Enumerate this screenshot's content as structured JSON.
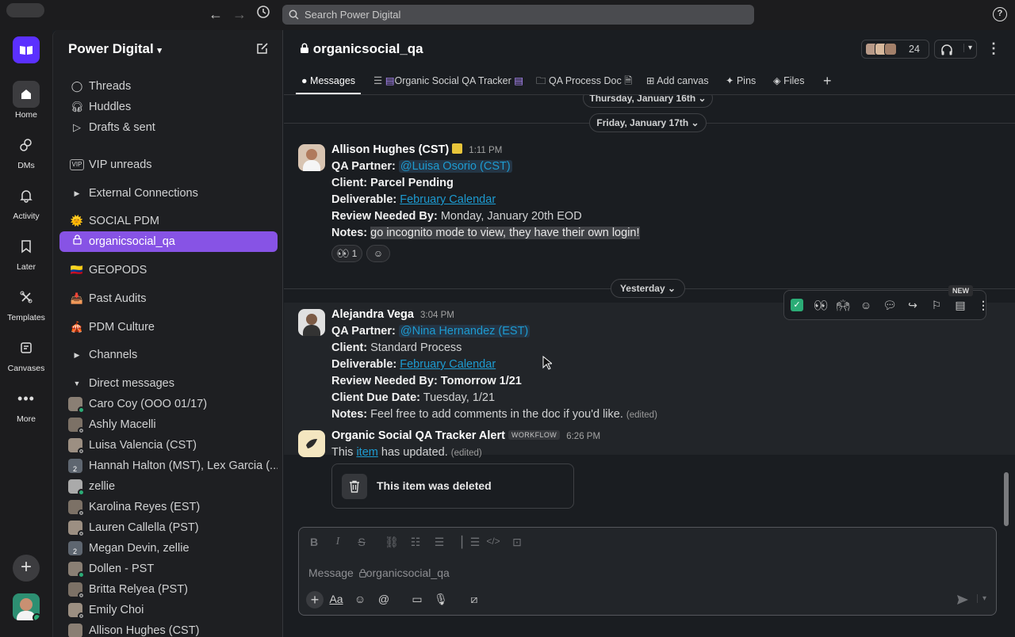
{
  "search": {
    "placeholder": "Search Power Digital"
  },
  "help_icon": "?",
  "rail": [
    {
      "label": "Home",
      "icon": "home-icon"
    },
    {
      "label": "DMs",
      "icon": "dms-icon"
    },
    {
      "label": "Activity",
      "icon": "bell-icon"
    },
    {
      "label": "Later",
      "icon": "bookmark-icon"
    },
    {
      "label": "Templates",
      "icon": "templates-icon"
    },
    {
      "label": "Canvases",
      "icon": "canvas-icon"
    },
    {
      "label": "More",
      "icon": "more-icon"
    }
  ],
  "workspace": {
    "name": "Power Digital"
  },
  "sidebar": {
    "top": [
      "Threads",
      "Huddles",
      "Drafts & sent",
      "VIP unreads",
      "External Connections"
    ],
    "channels": [
      "SOCIAL PDM",
      "organicsocial_qa",
      "GEOPODS",
      "Past Audits",
      "PDM Culture",
      "Channels",
      "Direct messages"
    ],
    "dms": [
      "Caro Coy (OOO 01/17)",
      "Ashly Macelli",
      "Luisa Valencia (CST)",
      "Hannah Halton (MST), Lex Garcia (...",
      "zellie",
      "Karolina Reyes (EST)",
      "Lauren Callella (PST)",
      "Megan Devin, zellie",
      "Dollen - PST",
      "Britta Relyea (PST)",
      "Emily Choi",
      "Allison Hughes (CST)"
    ],
    "group_count": "2"
  },
  "channel": {
    "name": "organicsocial_qa",
    "member_count": "24",
    "tabs": [
      "Messages",
      "Organic Social QA Tracker",
      "QA Process Doc",
      "Add canvas",
      "Pins",
      "Files"
    ]
  },
  "dates": {
    "d1": "Thursday, January 16th",
    "d2": "Friday, January 17th",
    "d3": "Yesterday"
  },
  "messages": {
    "m1": {
      "author": "Allison Hughes (CST)",
      "time": "1:11 PM",
      "qa_label": "QA Partner:",
      "qa": "@Luisa Osorio (CST)",
      "client_label": "Client:",
      "client": "Parcel Pending",
      "deliv_label": "Deliverable:",
      "deliv": "February Calendar",
      "review_label": "Review Needed By:",
      "review": "Monday, January 20th EOD",
      "notes_label": "Notes:",
      "notes": "go incognito mode to view, they have their own login!",
      "reaction_count": "1"
    },
    "m2": {
      "author": "Alejandra Vega",
      "time": "3:04 PM",
      "qa_label": "QA Partner:",
      "qa": "@Nina Hernandez (EST)",
      "client_label": "Client:",
      "client": "Standard Process",
      "deliv_label": "Deliverable:",
      "deliv": "February Calendar",
      "review_label": "Review Needed By: Tomorrow 1/21",
      "due_label": "Client Due Date:",
      "due": "Tuesday, 1/21",
      "notes_label": "Notes:",
      "notes": "Feel free to add comments in the doc if you'd like.",
      "edited": "(edited)"
    },
    "m3": {
      "author": "Organic Social QA Tracker Alert",
      "badge": "WORKFLOW",
      "time": "6:26 PM",
      "pre": "This",
      "link": "item",
      "post": "has updated.",
      "edited": "(edited)",
      "card": "This item was deleted"
    }
  },
  "hoverbar": {
    "new_label": "NEW"
  },
  "composer": {
    "placeholder": "Message",
    "channel": "organicsocial_qa"
  }
}
